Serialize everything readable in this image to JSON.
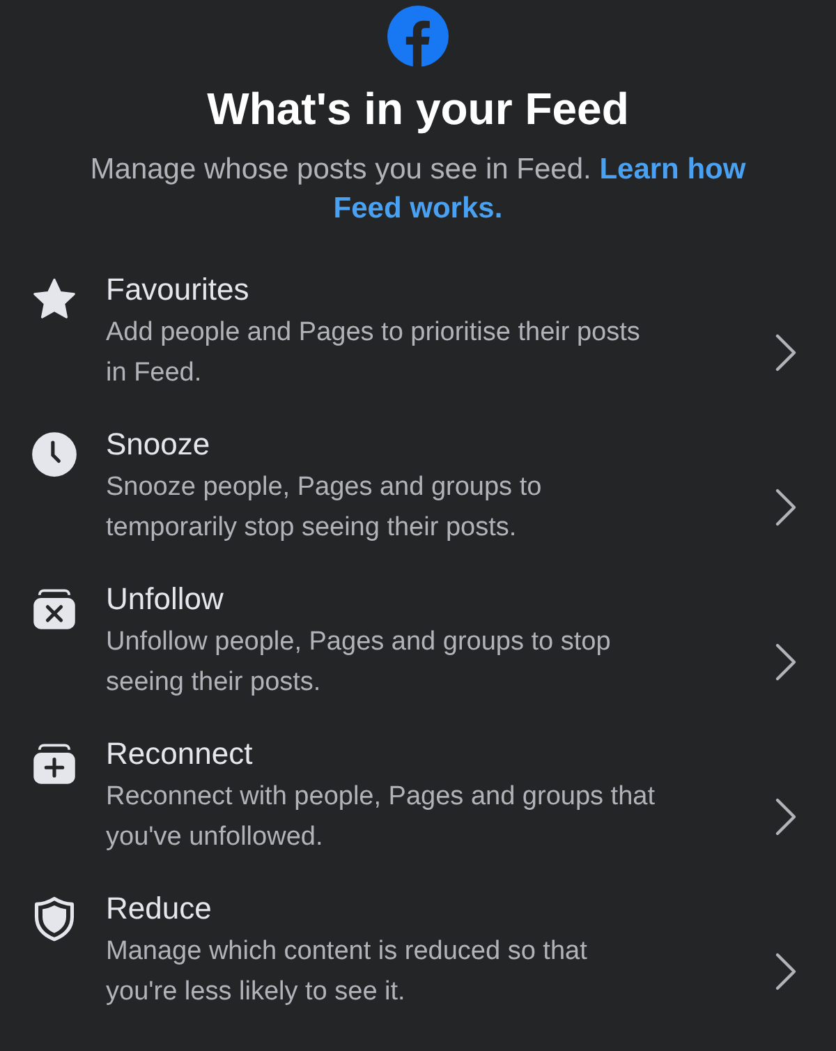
{
  "header": {
    "title": "What's in your Feed",
    "subtitle": "Manage whose posts you see in Feed.",
    "link_lines": [
      "Learn how",
      "Feed works."
    ]
  },
  "options": [
    {
      "kind": "star",
      "title": "Favourites",
      "description": "Add people and Pages to prioritise their posts in Feed."
    },
    {
      "kind": "clock",
      "title": "Snooze",
      "description": "Snooze people, Pages and groups to temporarily stop seeing their posts."
    },
    {
      "kind": "unfollow",
      "title": "Unfollow",
      "description": "Unfollow people, Pages and groups to stop seeing their posts."
    },
    {
      "kind": "reconnect",
      "title": "Reconnect",
      "description": "Reconnect with people, Pages and groups that you've unfollowed."
    },
    {
      "kind": "shield",
      "title": "Reduce",
      "description": "Manage which content is reduced so that you're less likely to see it."
    }
  ]
}
